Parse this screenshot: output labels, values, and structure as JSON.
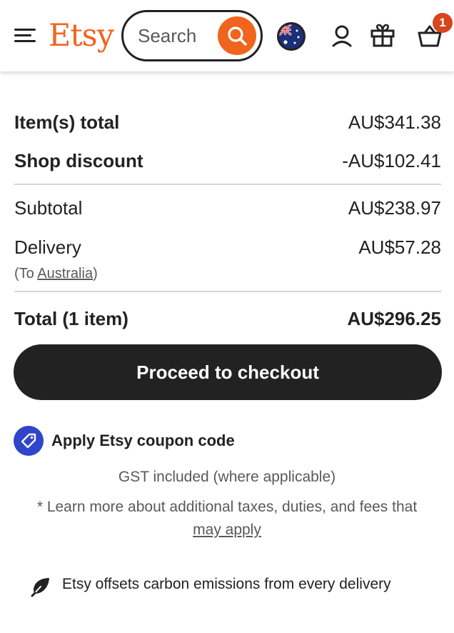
{
  "header": {
    "logo": "Etsy",
    "search_placeholder": "Search",
    "cart_count": "1",
    "brand_color": "#F1641E",
    "icons": [
      "menu-icon",
      "search-icon",
      "australia-flag-icon",
      "account-icon",
      "gift-icon",
      "basket-icon"
    ]
  },
  "summary": {
    "items_total_label": "Item(s) total",
    "items_total_value": "AU$341.38",
    "shop_discount_label": "Shop discount",
    "shop_discount_value": "-AU$102.41",
    "subtotal_label": "Subtotal",
    "subtotal_value": "AU$238.97",
    "delivery_label": "Delivery",
    "delivery_value": "AU$57.28",
    "delivery_note_prefix": "(To ",
    "delivery_destination": "Australia",
    "delivery_note_suffix": ")",
    "total_label": "Total (1 item)",
    "total_value": "AU$296.25"
  },
  "checkout_button": "Proceed to checkout",
  "coupon": {
    "label": "Apply Etsy coupon code",
    "icon": "tag-icon",
    "icon_color": "#2F45CA"
  },
  "tax": {
    "gst_note": "GST included (where applicable)",
    "learn_more_text": "* Learn more about additional taxes, duties, and fees that",
    "learn_more_link": "may apply"
  },
  "carbon": {
    "text": "Etsy offsets carbon emissions from every delivery",
    "icon": "leaf-icon"
  }
}
